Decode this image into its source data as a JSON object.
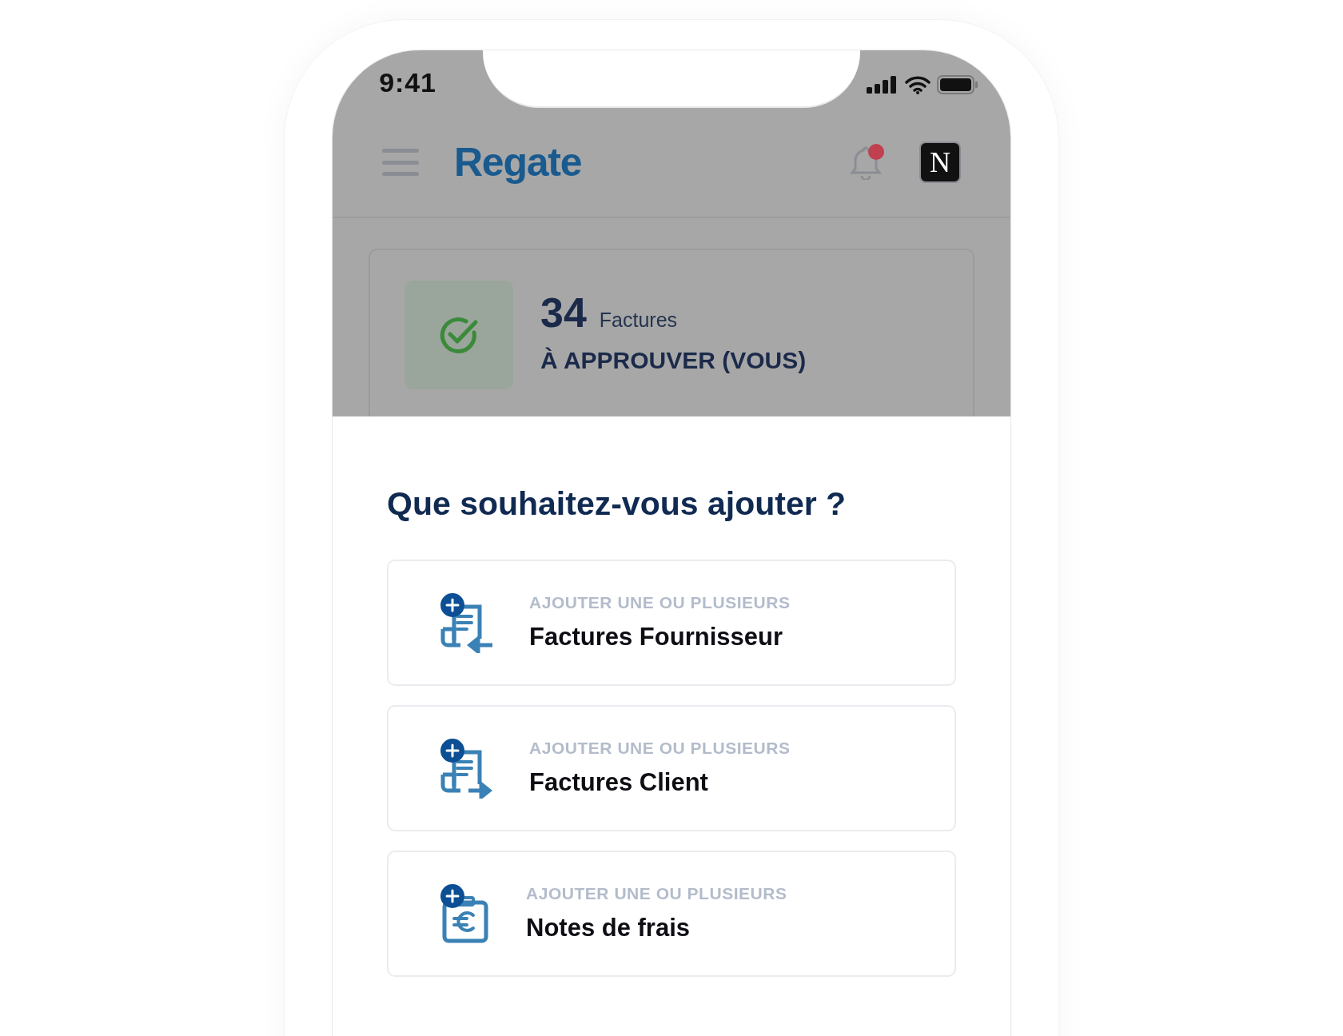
{
  "status_bar": {
    "time": "9:41"
  },
  "header": {
    "logo": "Regate",
    "notifications": {
      "unread": true
    },
    "avatar": {
      "letter": "N"
    }
  },
  "summary_card": {
    "count": "34",
    "unit": "Factures",
    "label": "À APPROUVER (VOUS)"
  },
  "add_sheet": {
    "title": "Que souhaitez-vous ajouter ?",
    "options": [
      {
        "kind": "supplier-invoice",
        "caption": "AJOUTER UNE OU PLUSIEURS",
        "title": "Factures Fournisseur"
      },
      {
        "kind": "client-invoice",
        "caption": "AJOUTER UNE OU PLUSIEURS",
        "title": "Factures Client"
      },
      {
        "kind": "expense",
        "caption": "AJOUTER UNE OU PLUSIEURS",
        "title": "Notes de frais"
      }
    ]
  }
}
